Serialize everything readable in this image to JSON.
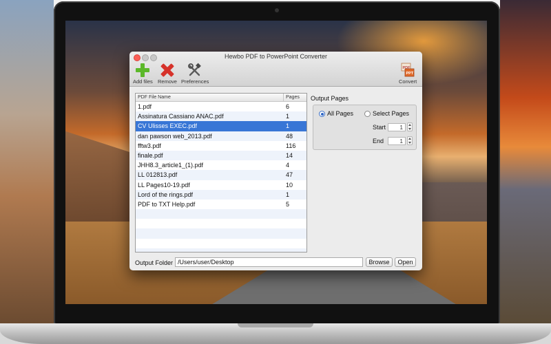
{
  "window": {
    "title": "Hewbo PDF to PowerPoint Converter"
  },
  "toolbar": {
    "add_label": "Add files",
    "remove_label": "Remove",
    "preferences_label": "Preferences",
    "convert_label": "Convert",
    "convert_icon_text_top": "PDF",
    "convert_icon_text_bottom": "PPT"
  },
  "table": {
    "columns": [
      "PDF File Name",
      "Pages"
    ],
    "rows": [
      {
        "name": "1.pdf",
        "pages": "6"
      },
      {
        "name": "Assinatura Cassiano ANAC.pdf",
        "pages": "1"
      },
      {
        "name": "CV Ulisses EXEC.pdf",
        "pages": "1",
        "selected": true
      },
      {
        "name": "dan pawson web_2013.pdf",
        "pages": "48"
      },
      {
        "name": "fftw3.pdf",
        "pages": "116"
      },
      {
        "name": "finale.pdf",
        "pages": "14"
      },
      {
        "name": "JHH8.3_article1_(1).pdf",
        "pages": "4"
      },
      {
        "name": "LL 012813.pdf",
        "pages": "47"
      },
      {
        "name": "LL Pages10-19.pdf",
        "pages": "10"
      },
      {
        "name": "Lord of the rings.pdf",
        "pages": "1"
      },
      {
        "name": "PDF to TXT Help.pdf",
        "pages": "5"
      }
    ]
  },
  "output_pages": {
    "label": "Output Pages",
    "all_pages_label": "All Pages",
    "select_pages_label": "Select Pages",
    "selected_option": "All Pages",
    "start_label": "Start",
    "start_value": "1",
    "end_label": "End",
    "end_value": "1"
  },
  "output_folder": {
    "label": "Output Folder",
    "value": "/Users/user/Desktop",
    "browse_label": "Browse",
    "open_label": "Open"
  },
  "colors": {
    "selection": "#3876d6",
    "close": "#fc5f57"
  },
  "icons": [
    "add-files-icon",
    "remove-icon",
    "preferences-icon",
    "convert-icon"
  ]
}
